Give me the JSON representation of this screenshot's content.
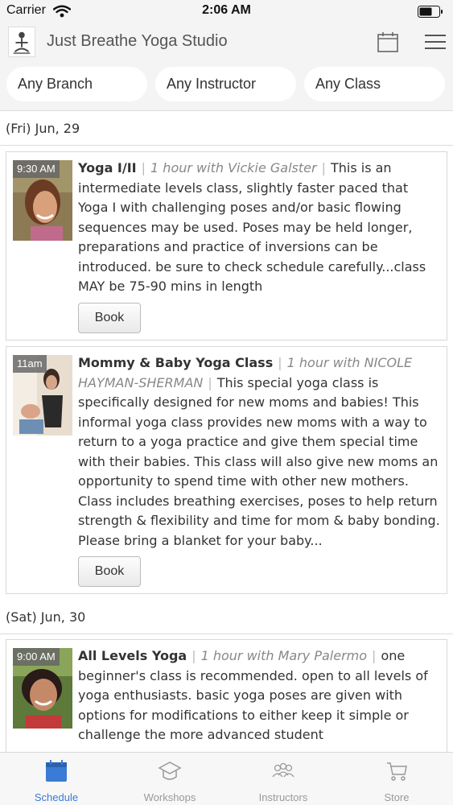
{
  "status_bar": {
    "carrier": "Carrier",
    "time": "2:06 AM"
  },
  "nav": {
    "title": "Just Breathe Yoga Studio"
  },
  "filters": {
    "branch": "Any Branch",
    "instructor": "Any Instructor",
    "class": "Any Class"
  },
  "schedule": [
    {
      "date": "(Fri) Jun, 29",
      "classes": [
        {
          "time": "9:30 AM",
          "name": "Yoga I/II",
          "meta": "1 hour with Vickie Galster",
          "description": "This is an intermediate levels class, slightly faster paced that Yoga I with challenging poses and/or basic flowing sequences may be used. Poses may be held longer, preparations and practice of inversions can be introduced. be sure to check schedule carefully...class MAY be 75-90 mins in length",
          "book_label": "Book"
        },
        {
          "time": "11am",
          "name": "Mommy & Baby Yoga Class",
          "meta": "1 hour with NICOLE HAYMAN-SHERMAN",
          "description": "This special yoga class is specifically designed for new moms and babies! This informal yoga class provides new moms with a way to return to a yoga practice and give them special time with their babies. This class will also give new moms an opportunity to spend time with other new mothers. Class includes breathing exercises, poses to help return strength & flexibility and time for mom & baby bonding. Please bring a blanket for your baby...",
          "book_label": "Book"
        }
      ]
    },
    {
      "date": "(Sat) Jun, 30",
      "classes": [
        {
          "time": "9:00 AM",
          "name": "All Levels Yoga",
          "meta": "1 hour with Mary Palermo",
          "description": "one beginner's class is recommended. open to all levels of yoga enthusiasts. basic yoga poses are given with options for modifications to either keep it simple or challenge the more advanced student"
        }
      ]
    }
  ],
  "tabs": [
    {
      "label": "Schedule",
      "icon": "calendar-icon",
      "active": true
    },
    {
      "label": "Workshops",
      "icon": "graduation-cap-icon",
      "active": false
    },
    {
      "label": "Instructors",
      "icon": "people-icon",
      "active": false
    },
    {
      "label": "Store",
      "icon": "cart-icon",
      "active": false
    }
  ],
  "colors": {
    "accent": "#3a7bd5",
    "background": "#f4f4f4"
  }
}
